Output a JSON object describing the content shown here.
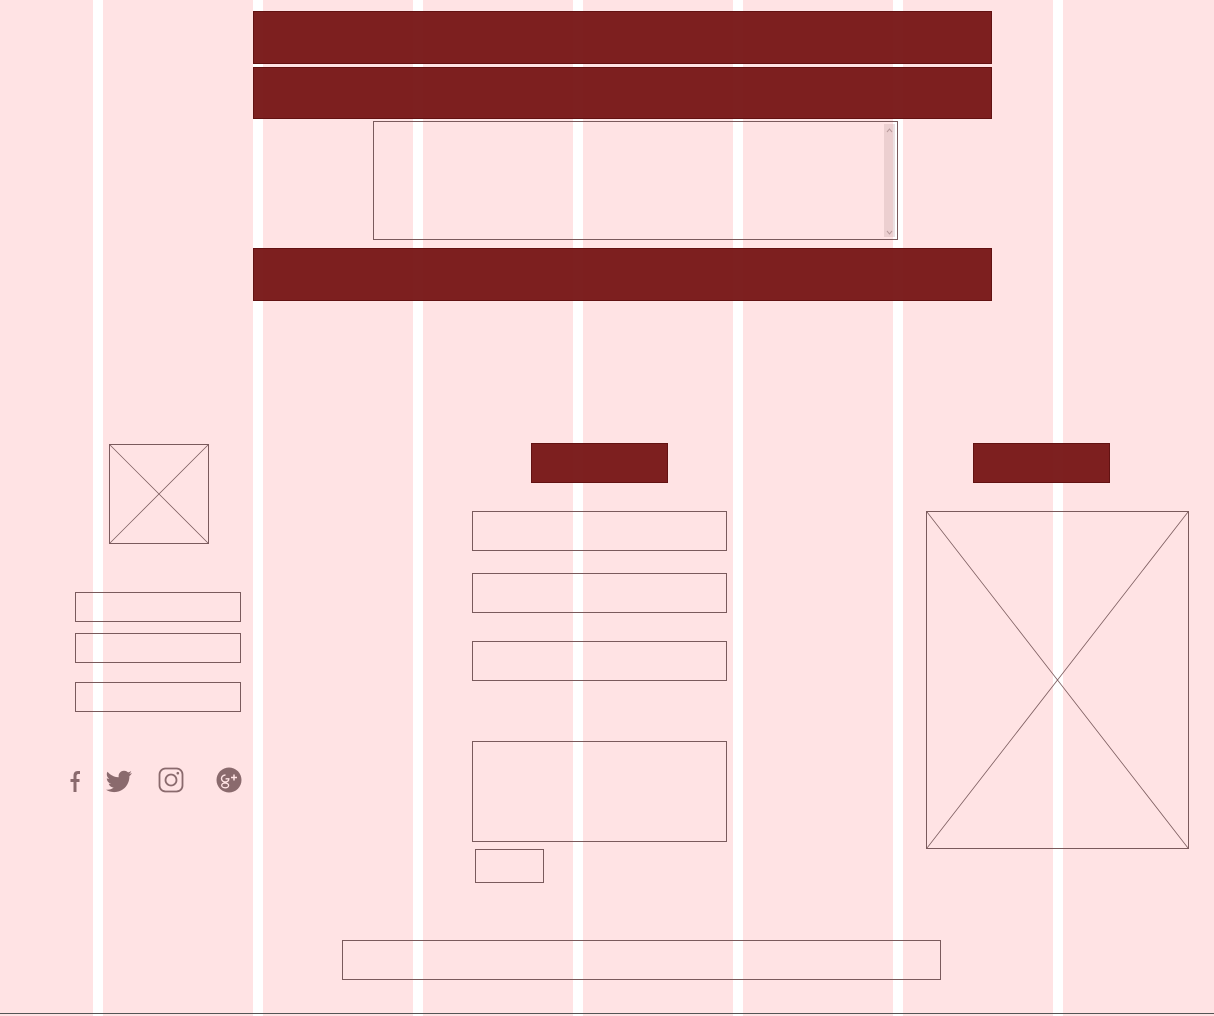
{
  "colors": {
    "background": "#ffe3e4",
    "column_gap": "#ffffff",
    "banner": "#761414",
    "outline": "#7a5a5c",
    "icon": "#8a6a6d"
  },
  "header": {
    "banner_top": "",
    "banner_nav": ""
  },
  "intro": {
    "text_area": ""
  },
  "cta_banner": {
    "label": ""
  },
  "left_column": {
    "logo_image": "image-placeholder",
    "fields": [
      "",
      "",
      ""
    ],
    "social_icons": [
      "facebook-icon",
      "twitter-icon",
      "instagram-icon",
      "google-plus-icon"
    ]
  },
  "contact_form": {
    "heading": "",
    "fields": [
      "",
      "",
      ""
    ],
    "message": "",
    "submit_label": ""
  },
  "right_column": {
    "heading": "",
    "image": "image-placeholder"
  },
  "footer": {
    "text": ""
  }
}
